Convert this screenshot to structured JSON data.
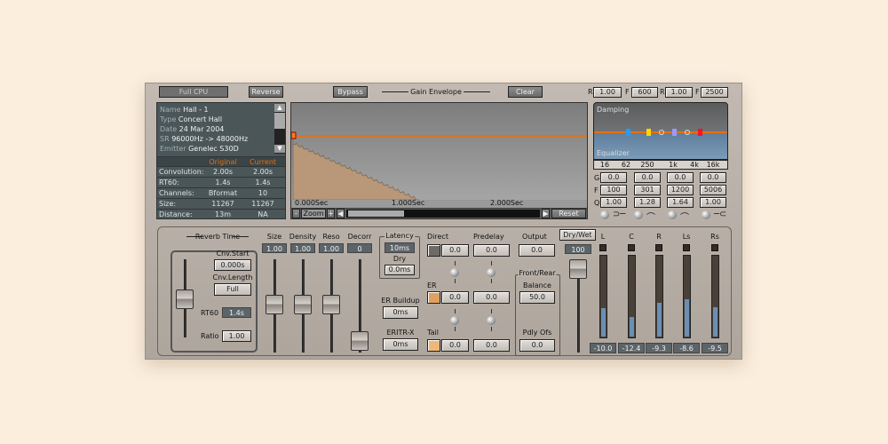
{
  "toolbar": {
    "full_cpu": "Full CPU",
    "reverse": "Reverse",
    "bypass": "Bypass",
    "gain_envelope": "Gain Envelope",
    "clear": "Clear"
  },
  "filters": {
    "r1_label": "R",
    "r1": "1.00",
    "f1_label": "F",
    "f1": "600",
    "r2_label": "R",
    "r2": "1.00",
    "f2_label": "F",
    "f2": "2500"
  },
  "info": {
    "name_k": "Name",
    "name": "Hall - 1",
    "type_k": "Type",
    "type": "Concert Hall",
    "date_k": "Date",
    "date": "24 Mar 2004",
    "sr_k": "SR",
    "sr": "96000Hz -> 48000Hz",
    "emitter_k": "Emitter",
    "emitter": "Genelec S30D"
  },
  "table": {
    "headers": [
      "Original",
      "Current"
    ],
    "rows": [
      {
        "label": "Convolution:",
        "original": "2.00s",
        "current": "2.00s"
      },
      {
        "label": "RT60:",
        "original": "1.4s",
        "current": "1.4s"
      },
      {
        "label": "Channels:",
        "original": "Bformat",
        "current": "10"
      },
      {
        "label": "Size:",
        "original": "11267",
        "current": "11267"
      },
      {
        "label": "Distance:",
        "original": "13m",
        "current": "NA"
      }
    ]
  },
  "envelope": {
    "t0": "0.000Sec",
    "t1": "1.000Sec",
    "t2": "2.000Sec",
    "zoom": "Zoom",
    "minus": "-",
    "plus": "+",
    "reset": "Reset",
    "colors": {
      "line": "#e8700a",
      "fill": "#b89878"
    }
  },
  "eq": {
    "damping": "Damping",
    "equalizer": "Equalizer",
    "freqs": [
      "16",
      "62",
      "250",
      "1k",
      "4k",
      "16k"
    ],
    "g_label": "G",
    "f_label": "F",
    "q_label": "Q",
    "g": [
      "0.0",
      "0.0",
      "0.0",
      "0.0"
    ],
    "f": [
      "100",
      "301",
      "1200",
      "5006"
    ],
    "q": [
      "1.00",
      "1.28",
      "1.64",
      "1.00"
    ]
  },
  "reverb": {
    "title": "Reverb Time",
    "cnv_start_label": "Cnv.Start",
    "cnv_start": "0.000s",
    "cnv_length_label": "Cnv.Length",
    "cnv_length": "Full",
    "rt60_label": "RT60",
    "rt60": "1.4s",
    "ratio_label": "Ratio",
    "ratio": "1.00"
  },
  "sliders": [
    {
      "label": "Size",
      "value": "1.00"
    },
    {
      "label": "Density",
      "value": "1.00"
    },
    {
      "label": "Reso",
      "value": "1.00"
    },
    {
      "label": "Decorr",
      "value": "0"
    }
  ],
  "latency": {
    "title": "Latency",
    "value": "10ms",
    "dry_label": "Dry",
    "dry": "0.0ms",
    "er_buildup_label": "ER Buildup",
    "er_buildup": "0ms",
    "eritr_label": "ERITR-X",
    "eritr": "0ms"
  },
  "levels": {
    "direct_label": "Direct",
    "predelay_label": "Predelay",
    "output_label": "Output",
    "er_label": "ER",
    "tail_label": "Tail",
    "direct": "0.0",
    "direct_pd": "0.0",
    "output": "0.0",
    "er": "0.0",
    "er_pd": "0.0",
    "tail": "0.0",
    "tail_pd": "0.0"
  },
  "frontrear": {
    "title": "Front/Rear",
    "balance_label": "Balance",
    "balance": "50.0",
    "pdly_label": "Pdly Ofs",
    "pdly": "0.0"
  },
  "drywet": {
    "label": "Dry/Wet",
    "value": "100"
  },
  "meters": [
    {
      "label": "L",
      "value": "-10.0",
      "level": 0.35
    },
    {
      "label": "C",
      "value": "-12.4",
      "level": 0.24
    },
    {
      "label": "R",
      "value": "-9.3",
      "level": 0.41
    },
    {
      "label": "Ls",
      "value": "-8.6",
      "level": 0.46
    },
    {
      "label": "Rs",
      "value": "-9.5",
      "level": 0.36
    }
  ]
}
